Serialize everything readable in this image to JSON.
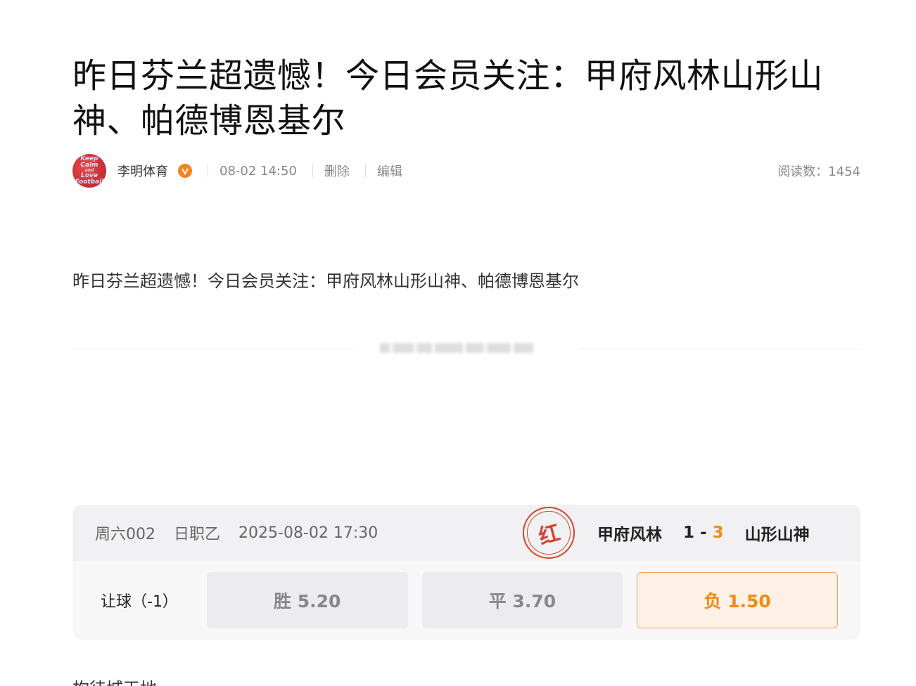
{
  "article": {
    "title": "昨日芬兰超遗憾！今日会员关注：甲府风林山形山神、帕德博恩基尔",
    "summary": "昨日芬兰超遗憾！今日会员关注：甲府风林山形山神、帕德博恩基尔",
    "next_line": "构待城天地"
  },
  "meta": {
    "avatar_text": [
      "Keep",
      "Calm",
      "and",
      "Love",
      "Football"
    ],
    "author": "李明体育",
    "time": "08-02 14:50",
    "delete_label": "删除",
    "edit_label": "编辑",
    "reads": "阅读数：1454"
  },
  "match_card": {
    "code": "周六002",
    "league": "日职乙",
    "datetime": "2025-08-02 17:30",
    "stamp": "红",
    "home_team": "甲府风林",
    "home_score": "1",
    "score_sep": "-",
    "away_score": "3",
    "away_team": "山形山神",
    "handicap_label": "让球（-1）",
    "odds": [
      {
        "label": "胜 5.20",
        "selected": false
      },
      {
        "label": "平 3.70",
        "selected": false
      },
      {
        "label": "负 1.50",
        "selected": true
      }
    ]
  },
  "colors": {
    "accent_orange": "#f28a17",
    "stamp_red": "#d5442f",
    "verified_badge": "#f5831f"
  }
}
